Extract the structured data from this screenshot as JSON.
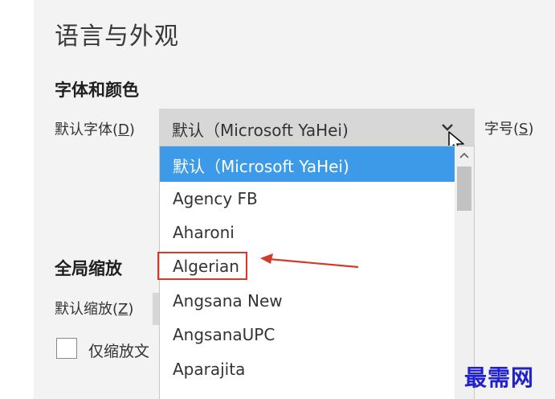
{
  "page": {
    "title": "语言与外观"
  },
  "font_section": {
    "title": "字体和颜色",
    "default_font_label": "默认字体(",
    "default_font_key": "D",
    "default_font_label_end": ")",
    "selected_value": "默认（Microsoft YaHei)",
    "size_label": "字号(",
    "size_key": "S",
    "size_label_end": ")"
  },
  "dropdown": {
    "options": [
      "默认（Microsoft YaHei)",
      "Agency FB",
      "Aharoni",
      "Algerian",
      "Angsana New",
      "AngsanaUPC",
      "Aparajita"
    ],
    "selected_index": 0,
    "highlighted_index": 3,
    "scroll_fraction": 0.0
  },
  "zoom_section": {
    "title": "全局缩放",
    "default_zoom_label": "默认缩放(",
    "default_zoom_key": "Z",
    "default_zoom_label_end": ")",
    "checkbox_label": "仅缩放文"
  },
  "watermark": {
    "text": "最需网"
  },
  "colors": {
    "selection": "#3d9ae8",
    "annotation": "#d23a2a",
    "watermark": "#2222cc"
  },
  "icons": [
    "chevron-down-icon",
    "mouse-cursor-icon",
    "scroll-up-icon",
    "annotation-arrow"
  ]
}
